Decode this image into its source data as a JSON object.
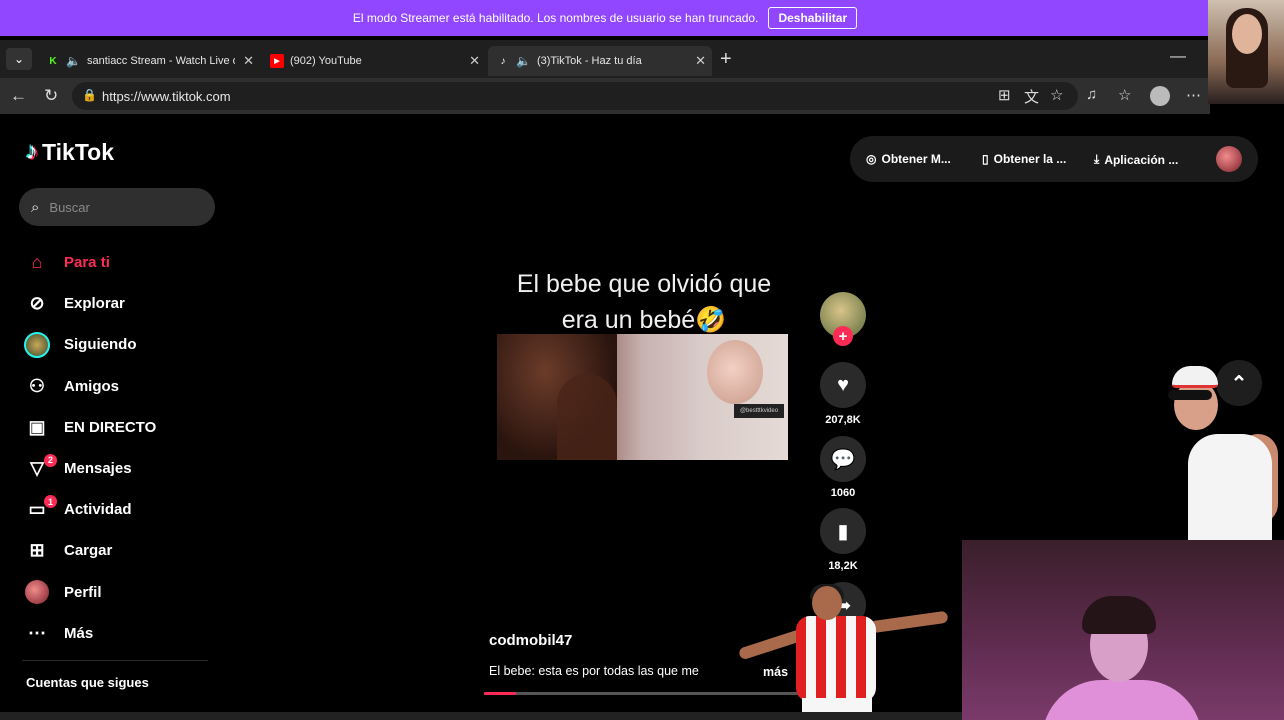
{
  "banner": {
    "message": "El modo Streamer está habilitado. Los nombres de usuario se han truncado.",
    "button": "Deshabilitar"
  },
  "browser": {
    "tabs": [
      {
        "title": "santiacc Stream - Watch Live o",
        "favicon": "kick-icon",
        "active": false
      },
      {
        "title": "(902) YouTube",
        "favicon": "youtube-icon",
        "active": false
      },
      {
        "title": "(3)TikTok - Haz tu día",
        "favicon": "tiktok-icon",
        "active": true
      }
    ],
    "url": "https://www.tiktok.com"
  },
  "tiktok": {
    "logo_text": "TikTok",
    "search_placeholder": "Buscar",
    "nav": [
      {
        "label": "Para ti",
        "icon": "home-icon",
        "active": true
      },
      {
        "label": "Explorar",
        "icon": "compass-icon"
      },
      {
        "label": "Siguiendo",
        "icon": "following-avatar"
      },
      {
        "label": "Amigos",
        "icon": "friends-icon"
      },
      {
        "label": "EN DIRECTO",
        "icon": "live-icon"
      },
      {
        "label": "Mensajes",
        "icon": "messages-icon",
        "badge": "2"
      },
      {
        "label": "Actividad",
        "icon": "activity-icon",
        "badge": "1"
      },
      {
        "label": "Cargar",
        "icon": "upload-icon"
      },
      {
        "label": "Perfil",
        "icon": "profile-avatar"
      },
      {
        "label": "Más",
        "icon": "more-icon"
      }
    ],
    "following_header": "Cuentas que sigues",
    "topbar": {
      "coins": "Obtener M...",
      "get_app": "Obtener la ...",
      "desktop_app": "Aplicación ..."
    },
    "video": {
      "caption_line1": "El bebe que olvidó que",
      "caption_line2": "era un bebé🤣",
      "watermark": "@bestttkvideo",
      "author": "codmobil47",
      "description": "El bebe: esta es por todas las que me",
      "more": "más",
      "progress": 0.1
    },
    "actions": {
      "likes": "207,8K",
      "comments": "1060",
      "saves": "18,2K"
    }
  },
  "colors": {
    "tiktok_red": "#fe2c55",
    "tiktok_cyan": "#25f4ee",
    "twitch_purple": "#9146ff"
  }
}
